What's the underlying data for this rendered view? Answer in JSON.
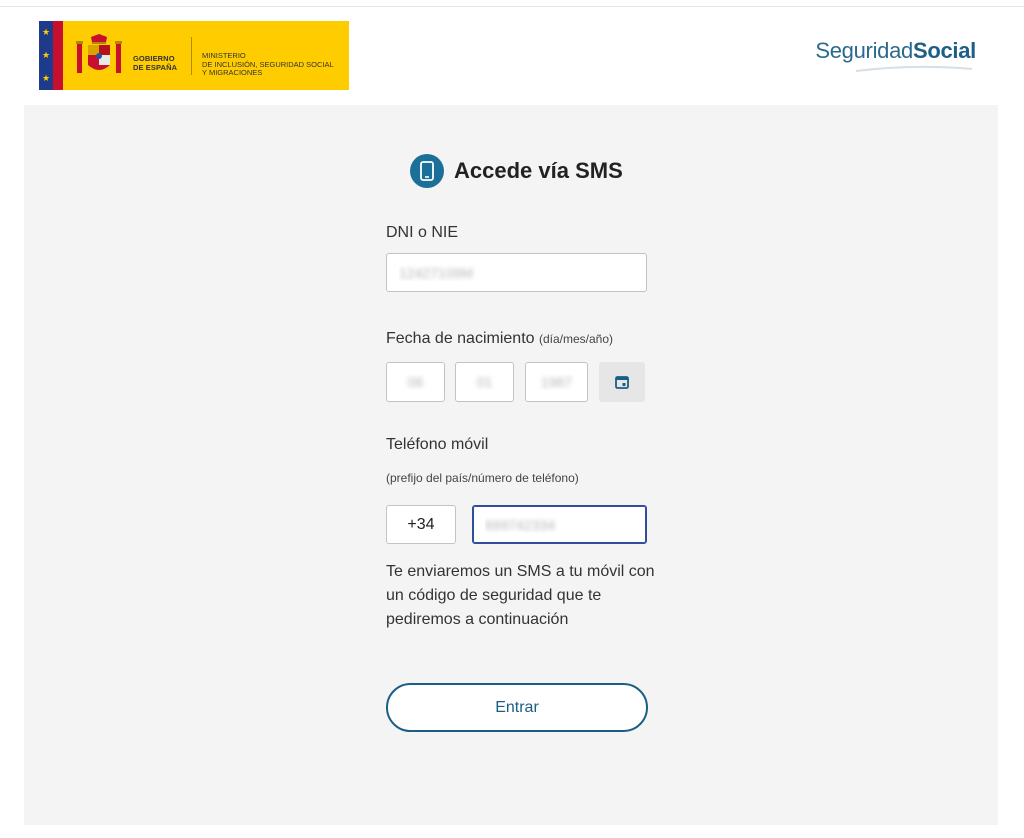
{
  "header": {
    "gov_logo": {
      "gobierno_lines": [
        "GOBIERNO",
        "DE ESPAÑA"
      ],
      "ministerio_lines": [
        "MINISTERIO",
        "DE INCLUSIÓN, SEGURIDAD SOCIAL",
        "Y MIGRACIONES"
      ]
    },
    "brand": {
      "light": "Seguridad",
      "bold": "Social"
    }
  },
  "form": {
    "title": "Accede vía SMS",
    "dni": {
      "label": "DNI o NIE",
      "value": "12427109M"
    },
    "birthdate": {
      "label": "Fecha de nacimiento",
      "format_hint": "(día/mes/año)",
      "day": "06",
      "month": "01",
      "year": "1967"
    },
    "phone": {
      "label": "Teléfono móvil",
      "hint": "(prefijo del país/número de teléfono)",
      "prefix": "+34",
      "number": "699742334"
    },
    "info_text": "Te enviaremos un SMS a tu móvil con un código de seguridad que te pediremos a continuación",
    "submit_label": "Entrar"
  },
  "colors": {
    "accent": "#1b5e84",
    "badge": "#1b6f99",
    "gov_yellow": "#ffcc00",
    "panel_bg": "#f4f4f4"
  },
  "icons": {
    "title": "smartphone-icon",
    "calendar": "calendar-icon"
  }
}
